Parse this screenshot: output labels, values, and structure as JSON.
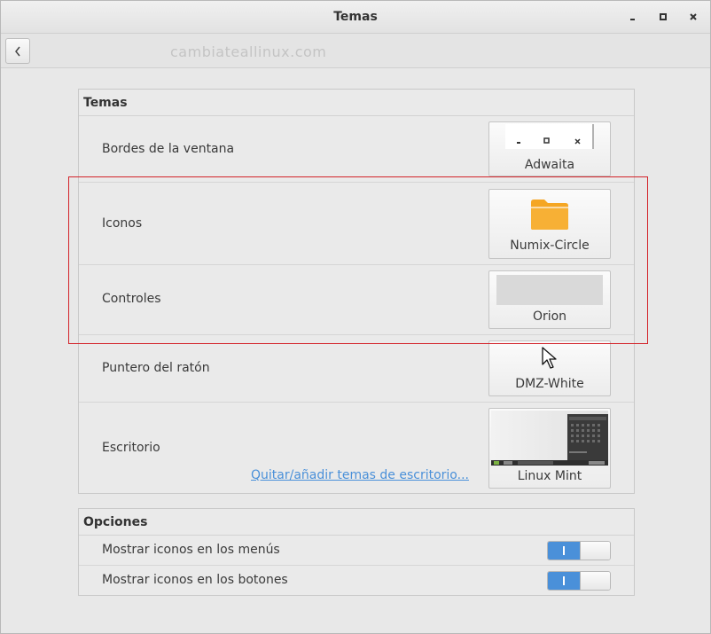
{
  "window": {
    "title": "Temas"
  },
  "toolbar": {
    "watermark": "cambiateallinux.com"
  },
  "themes_panel": {
    "header": "Temas",
    "rows": [
      {
        "label": "Bordes de la ventana",
        "button": "Adwaita"
      },
      {
        "label": "Iconos",
        "button": "Numix-Circle"
      },
      {
        "label": "Controles",
        "button": "Orion"
      },
      {
        "label": "Puntero del ratón",
        "button": "DMZ-White"
      },
      {
        "label": "Escritorio",
        "button": "Linux Mint"
      }
    ],
    "link": "Quitar/añadir temas de escritorio..."
  },
  "options_panel": {
    "header": "Opciones",
    "rows": [
      {
        "label": "Mostrar iconos en los menús",
        "enabled": true
      },
      {
        "label": "Mostrar iconos en los botones",
        "enabled": true
      }
    ]
  },
  "colors": {
    "accent": "#4a90d9",
    "highlight_box": "#d3232a",
    "folder": "#f5a623"
  }
}
